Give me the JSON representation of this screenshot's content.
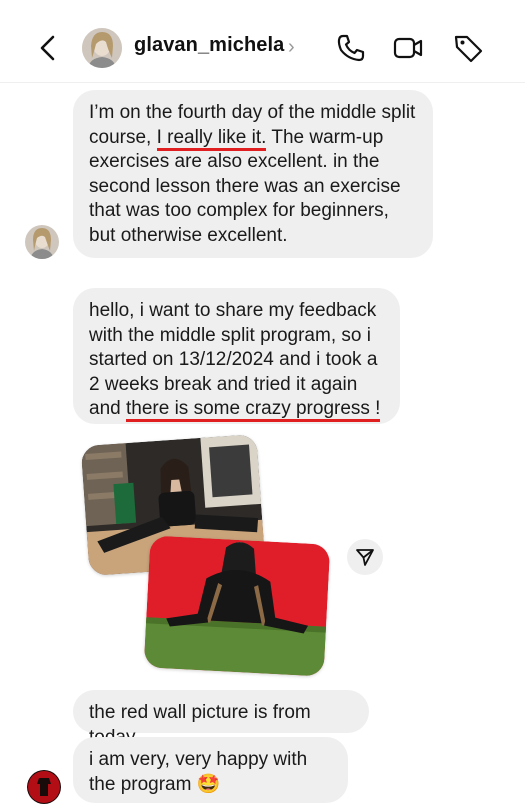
{
  "header": {
    "username": "glavan_michela",
    "chevron": "›",
    "icons": [
      "back-icon",
      "phone-icon",
      "video-icon",
      "tag-icon"
    ]
  },
  "messages": [
    {
      "id": "m1",
      "parts": [
        "I’m on the fourth day of the middle split course, ",
        "I really like it.",
        " The warm-up exercises are also excellent. in the second lesson there was an exercise that was too complex for beginners, but otherwise excellent."
      ]
    },
    {
      "id": "m2",
      "parts": [
        "hello, i want to share my feedback with the middle split program, so i started on 13/12/2024 and i took a 2 weeks break and tried it again and ",
        "there is some crazy progress !"
      ]
    },
    {
      "id": "m3",
      "text": "the red wall picture is from today"
    },
    {
      "id": "m4",
      "text": "i am very, very happy with the program",
      "emoji": "🤩"
    }
  ],
  "photos": [
    {
      "name": "studio-split-photo",
      "description_colors": {
        "floor": "#c9a37a",
        "wall": "#2b2b2b",
        "shelf": "#7a6a55"
      }
    },
    {
      "name": "red-wall-split-photo",
      "description_colors": {
        "wall": "#e01e2a",
        "floor": "#5d8a36",
        "top": "#1b1b1b"
      }
    }
  ],
  "colors": {
    "bubble": "#efefef",
    "underline": "#e02020",
    "text": "#1a1a1a"
  },
  "share_button": {
    "icon": "send-icon"
  }
}
